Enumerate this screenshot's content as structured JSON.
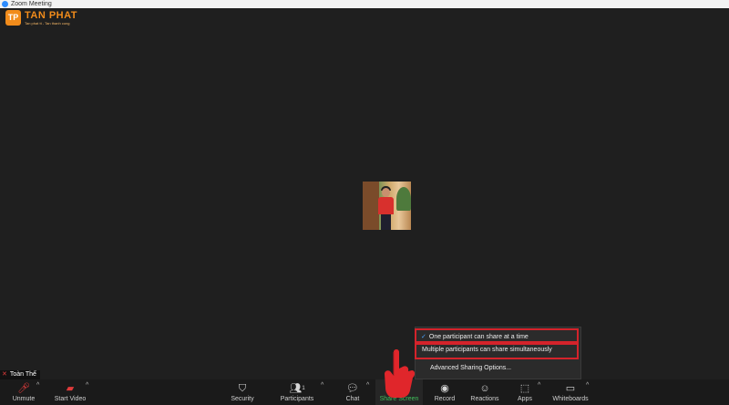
{
  "window": {
    "title": "Zoom Meeting"
  },
  "logo": {
    "mark": "TP",
    "brand": "TAN PHAT",
    "tagline": "Tan phat tt - Tan thanh cong"
  },
  "participant": {
    "name": "Toàn Thế"
  },
  "toolbar": {
    "unmute": "Unmute",
    "start_video": "Start Video",
    "security": "Security",
    "participants": "Participants",
    "participants_count": "1",
    "chat": "Chat",
    "share_screen": "Share Screen",
    "record": "Record",
    "reactions": "Reactions",
    "apps": "Apps",
    "whiteboards": "Whiteboards"
  },
  "share_menu": {
    "option_one": "One participant can share at a time",
    "option_multi": "Multiple participants can share simultaneously",
    "advanced": "Advanced Sharing Options...",
    "checked": "✓"
  },
  "colors": {
    "accent_green": "#3fbf5a",
    "highlight_red": "#d4232b",
    "brand_orange": "#f28c1b"
  }
}
